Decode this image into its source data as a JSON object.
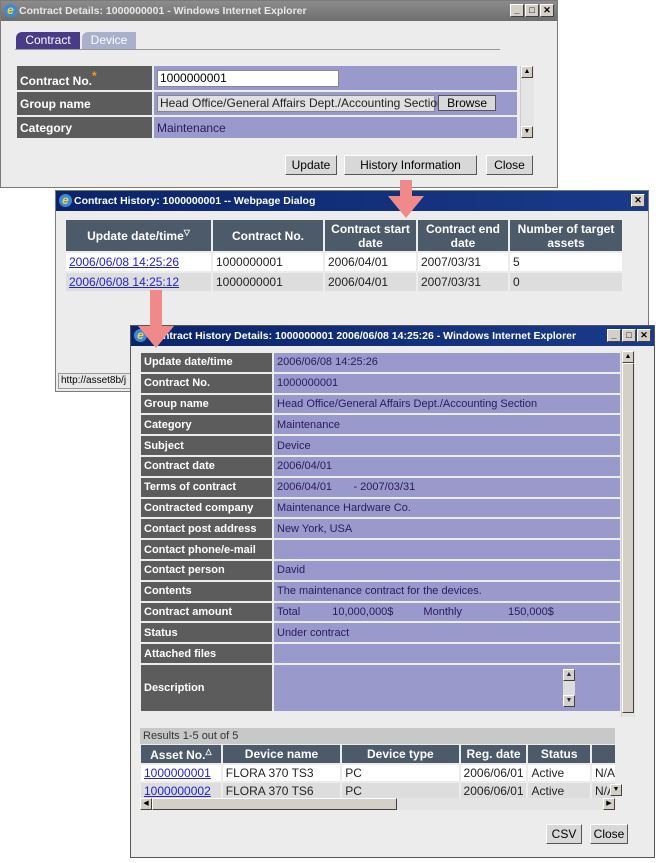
{
  "contract_window": {
    "title": "Contract Details: 1000000001 - Windows Internet Explorer",
    "tabs": [
      "Contract",
      "Device"
    ],
    "fields": {
      "contract_no_label": "Contract No.",
      "required_mark": "*",
      "contract_no_value": "1000000001",
      "group_label": "Group name",
      "group_value": "Head Office/General Affairs Dept./Accounting Section",
      "browse": "Browse",
      "category_label": "Category",
      "category_value": "Maintenance"
    },
    "buttons": {
      "update": "Update",
      "history": "History Information",
      "close": "Close"
    }
  },
  "history_dialog": {
    "title": "Contract History: 1000000001 -- Webpage Dialog",
    "columns": [
      "Update date/time",
      "Contract No.",
      "Contract start date",
      "Contract end date",
      "Number of target assets"
    ],
    "sort_icon": "▽",
    "rows": [
      [
        "2006/06/08 14:25:26",
        "1000000001",
        "2006/04/01",
        "2007/03/31",
        "5"
      ],
      [
        "2006/06/08 14:25:12",
        "1000000001",
        "2006/04/01",
        "2007/03/31",
        "0"
      ]
    ],
    "status_url": "http://asset8b/j"
  },
  "details_window": {
    "title": "Contract History Details: 1000000001 2006/06/08 14:25:26 - Windows Internet Explorer",
    "fields": [
      [
        "Update date/time",
        "2006/06/08 14:25:26"
      ],
      [
        "Contract No.",
        "1000000001"
      ],
      [
        "Group name",
        "Head Office/General Affairs Dept./Accounting Section"
      ],
      [
        "Category",
        "Maintenance"
      ],
      [
        "Subject",
        "Device"
      ],
      [
        "Contract date",
        "2006/04/01"
      ],
      [
        "Terms of contract",
        "2006/04/01       - 2007/03/31"
      ],
      [
        "Contracted company",
        "Maintenance Hardware Co."
      ],
      [
        "Contact post address",
        "New York, USA"
      ],
      [
        "Contact phone/e-mail",
        ""
      ],
      [
        "Contact person",
        "David"
      ],
      [
        "Contents",
        "The maintenance contract for the devices."
      ],
      [
        "Contract amount",
        ""
      ],
      [
        "Status",
        "Under contract"
      ],
      [
        "Attached files",
        ""
      ]
    ],
    "amount": {
      "total_label": "Total",
      "total_value": "10,000,000$",
      "monthly_label": "Monthly",
      "monthly_value": "150,000$"
    },
    "description_label": "Description",
    "results": "Results 1-5 out of 5",
    "asset_columns": [
      "Asset No.",
      "Device name",
      "Device type",
      "Reg. date",
      "Status",
      ""
    ],
    "asset_sort_icon": "△",
    "assets": [
      [
        "1000000001",
        "FLORA 370 TS3",
        "PC",
        "2006/06/01",
        "Active",
        "N/A"
      ],
      [
        "1000000002",
        "FLORA 370 TS6",
        "PC",
        "2006/06/01",
        "Active",
        "N/A"
      ]
    ],
    "buttons": {
      "csv": "CSV",
      "close": "Close"
    }
  },
  "colors": {
    "label_bg": "#5c5c5c",
    "value_bg": "#9999cc",
    "header_bg": "#4d5a6a",
    "arrow": "#f08a8a",
    "link": "#2222cc"
  }
}
